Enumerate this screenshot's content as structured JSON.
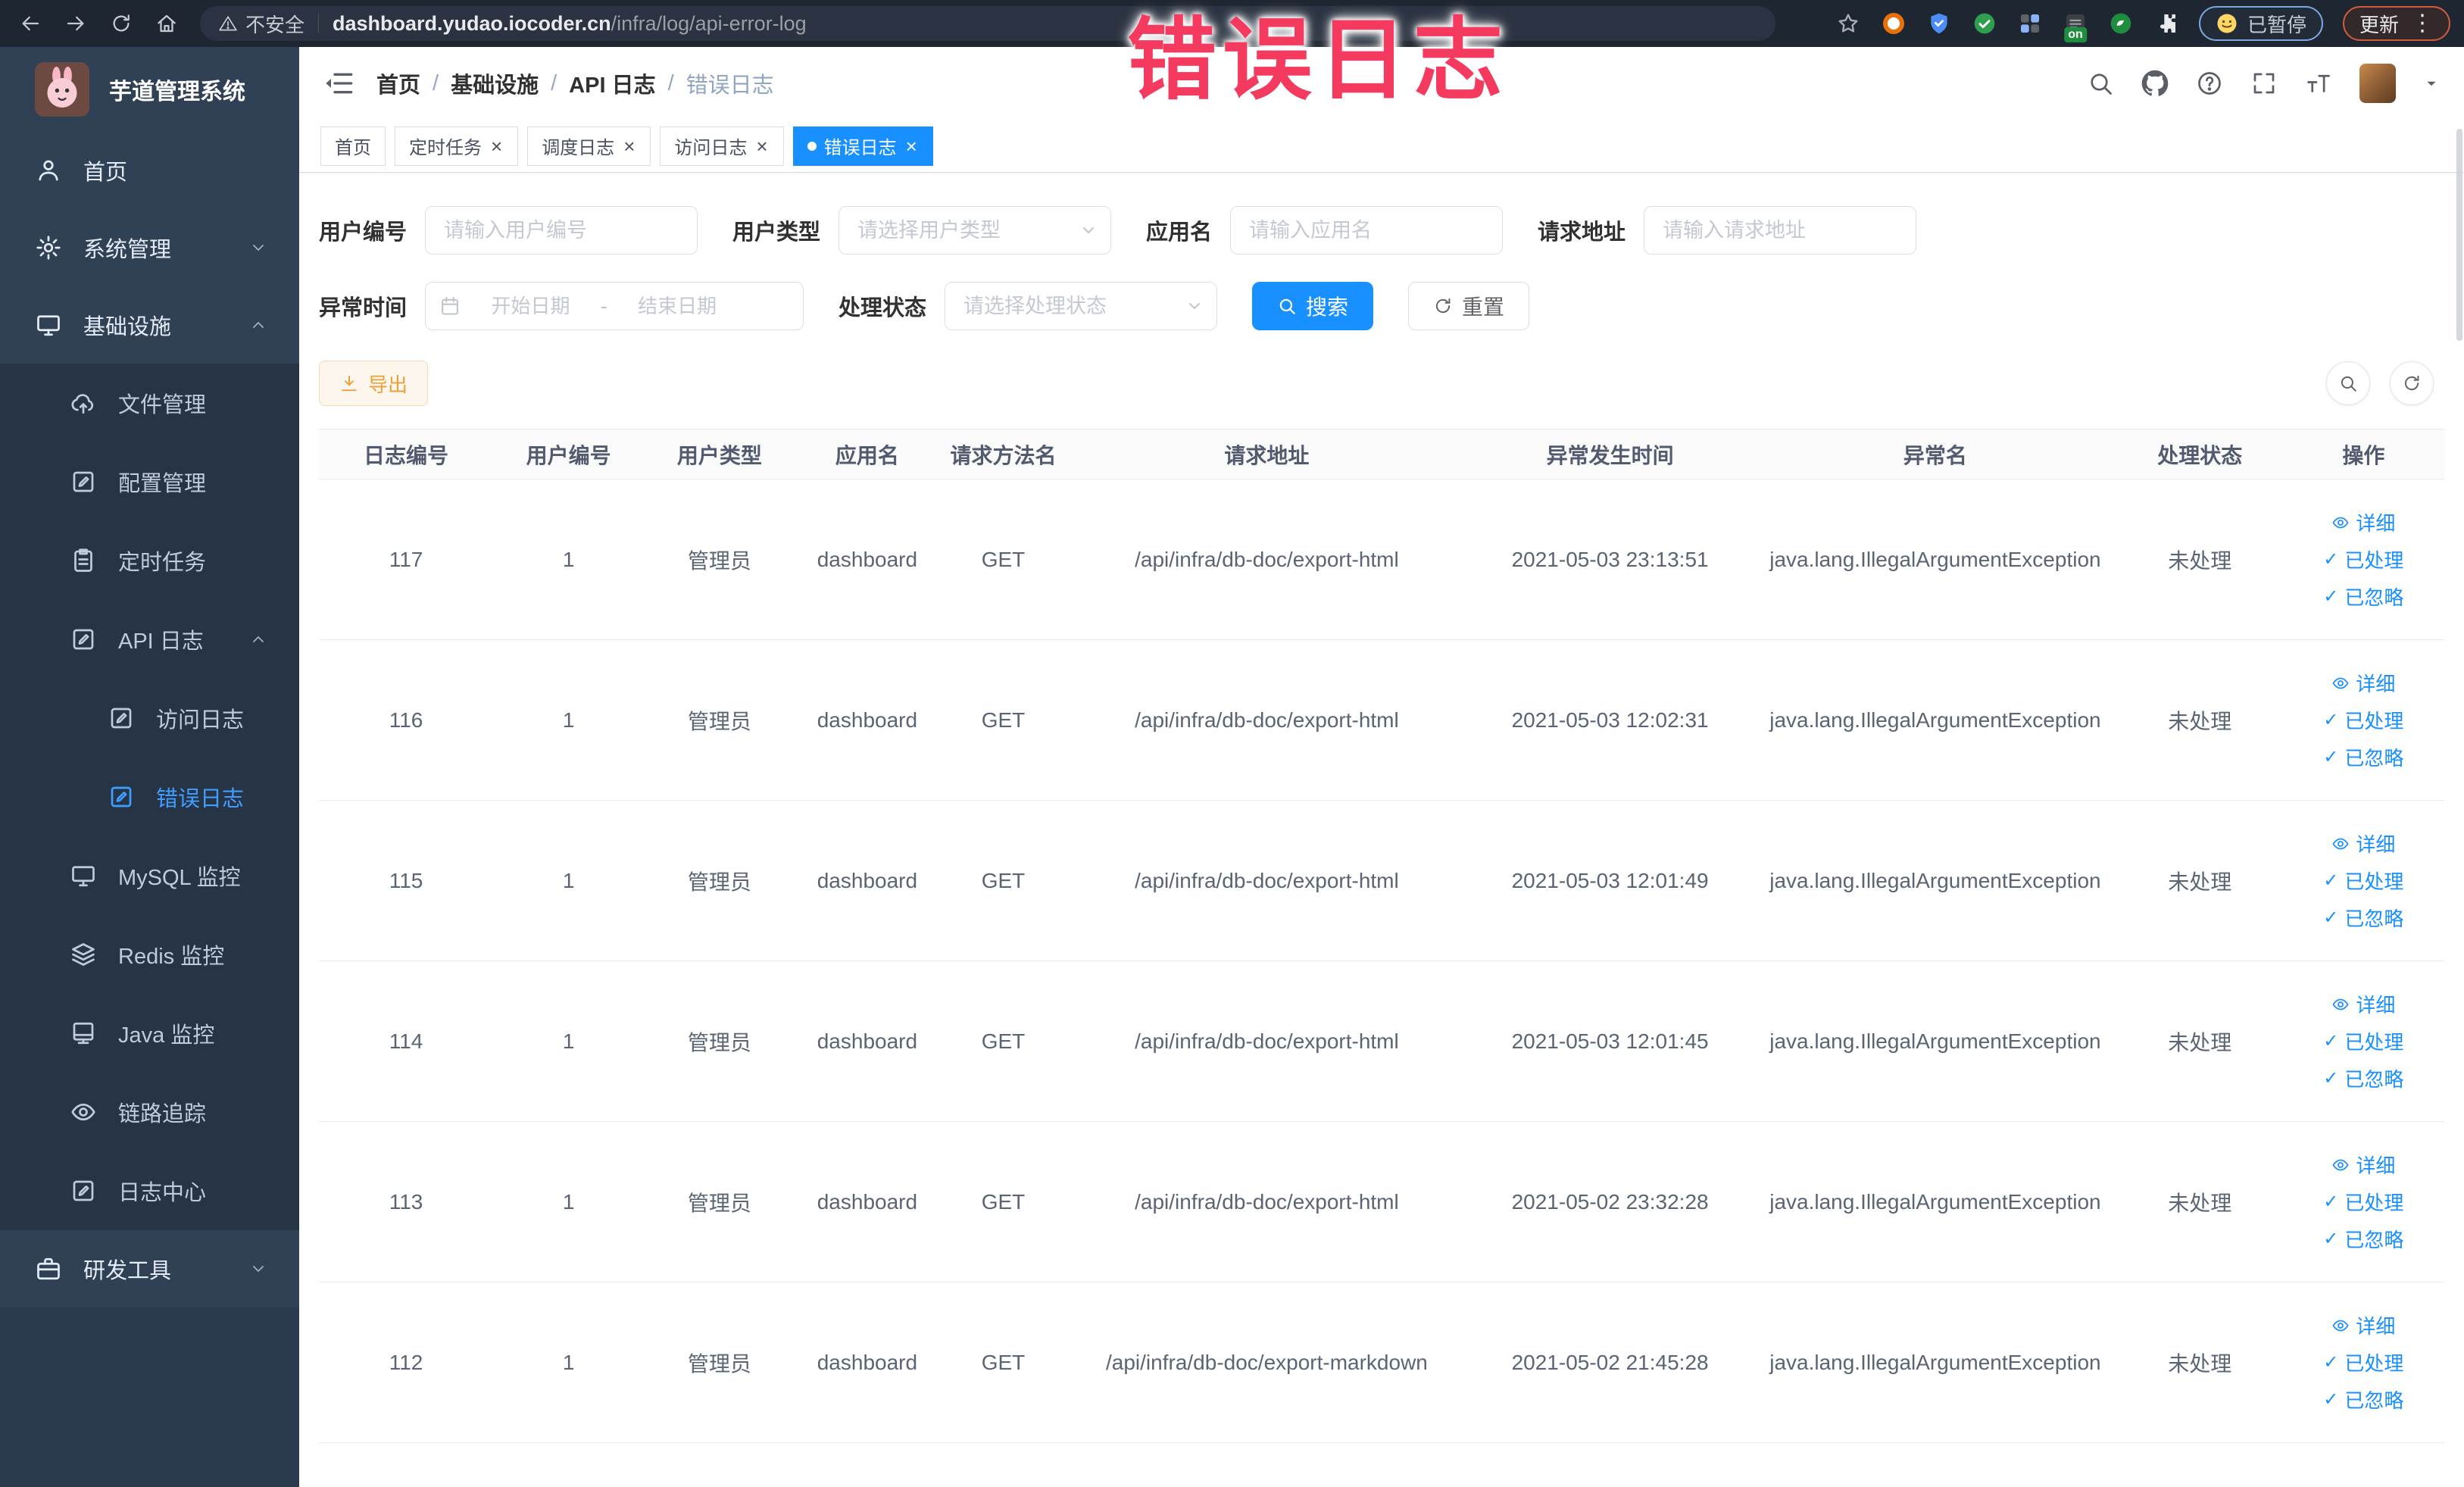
{
  "browser": {
    "security_label": "不安全",
    "url_domain": "dashboard.yudao.iocoder.cn",
    "url_path": "/infra/log/api-error-log",
    "paused_label": "已暂停",
    "update_label": "更新",
    "on_badge": "on"
  },
  "overlay": {
    "text": "错误日志",
    "color": "#f43a5f"
  },
  "sidebar": {
    "title": "芋道管理系统",
    "items": [
      {
        "slug": "home",
        "label": "首页",
        "icon": "home-icon",
        "level": 1
      },
      {
        "slug": "system-management",
        "label": "系统管理",
        "icon": "gear-icon",
        "level": 1,
        "chevron": "down"
      },
      {
        "slug": "infrastructure",
        "label": "基础设施",
        "icon": "monitor-icon",
        "level": 1,
        "chevron": "up"
      },
      {
        "slug": "file-management",
        "label": "文件管理",
        "icon": "cloud-upload-icon",
        "level": 2
      },
      {
        "slug": "config-management",
        "label": "配置管理",
        "icon": "edit-square-icon",
        "level": 2
      },
      {
        "slug": "scheduled-tasks",
        "label": "定时任务",
        "icon": "clipboard-icon",
        "level": 2
      },
      {
        "slug": "api-log",
        "label": "API 日志",
        "icon": "edit-square-icon",
        "level": 2,
        "chevron": "up"
      },
      {
        "slug": "access-log",
        "label": "访问日志",
        "icon": "edit-square-icon",
        "level": 3
      },
      {
        "slug": "error-log",
        "label": "错误日志",
        "icon": "edit-square-icon",
        "level": 3,
        "active": true
      },
      {
        "slug": "mysql-monitor",
        "label": "MySQL 监控",
        "icon": "monitor-icon",
        "level": 2
      },
      {
        "slug": "redis-monitor",
        "label": "Redis 监控",
        "icon": "stack-icon",
        "level": 2
      },
      {
        "slug": "java-monitor",
        "label": "Java 监控",
        "icon": "pc-icon",
        "level": 2
      },
      {
        "slug": "trace",
        "label": "链路追踪",
        "icon": "eye-icon",
        "level": 2
      },
      {
        "slug": "log-center",
        "label": "日志中心",
        "icon": "edit-square-icon",
        "level": 2
      },
      {
        "slug": "dev-tools",
        "label": "研发工具",
        "icon": "briefcase-icon",
        "level": 1,
        "chevron": "down"
      }
    ]
  },
  "header": {
    "breadcrumb": [
      "首页",
      "基础设施",
      "API 日志",
      "错误日志"
    ]
  },
  "tabs": [
    {
      "slug": "home",
      "label": "首页",
      "closable": false,
      "active": false
    },
    {
      "slug": "scheduled-tasks",
      "label": "定时任务",
      "closable": true,
      "active": false
    },
    {
      "slug": "schedule-log",
      "label": "调度日志",
      "closable": true,
      "active": false
    },
    {
      "slug": "access-log",
      "label": "访问日志",
      "closable": true,
      "active": false
    },
    {
      "slug": "error-log",
      "label": "错误日志",
      "closable": true,
      "active": true
    }
  ],
  "filters": {
    "user_id": {
      "label": "用户编号",
      "placeholder": "请输入用户编号"
    },
    "user_type": {
      "label": "用户类型",
      "placeholder": "请选择用户类型"
    },
    "app_name": {
      "label": "应用名",
      "placeholder": "请输入应用名"
    },
    "request_url": {
      "label": "请求地址",
      "placeholder": "请输入请求地址"
    },
    "exception_time": {
      "label": "异常时间",
      "start_placeholder": "开始日期",
      "separator": "-",
      "end_placeholder": "结束日期"
    },
    "process_status": {
      "label": "处理状态",
      "placeholder": "请选择处理状态"
    },
    "search_label": "搜索",
    "reset_label": "重置"
  },
  "toolbar": {
    "export_label": "导出"
  },
  "table": {
    "columns": [
      "日志编号",
      "用户编号",
      "用户类型",
      "应用名",
      "请求方法名",
      "请求地址",
      "异常发生时间",
      "异常名",
      "处理状态",
      "操作"
    ],
    "action_labels": [
      "详细",
      "已处理",
      "已忽略"
    ],
    "rows": [
      {
        "id": "117",
        "user_id": "1",
        "user_type": "管理员",
        "app": "dashboard",
        "method": "GET",
        "url": "/api/infra/db-doc/export-html",
        "time": "2021-05-03 23:13:51",
        "exception": "java.lang.IllegalArgumentException",
        "status": "未处理"
      },
      {
        "id": "116",
        "user_id": "1",
        "user_type": "管理员",
        "app": "dashboard",
        "method": "GET",
        "url": "/api/infra/db-doc/export-html",
        "time": "2021-05-03 12:02:31",
        "exception": "java.lang.IllegalArgumentException",
        "status": "未处理"
      },
      {
        "id": "115",
        "user_id": "1",
        "user_type": "管理员",
        "app": "dashboard",
        "method": "GET",
        "url": "/api/infra/db-doc/export-html",
        "time": "2021-05-03 12:01:49",
        "exception": "java.lang.IllegalArgumentException",
        "status": "未处理"
      },
      {
        "id": "114",
        "user_id": "1",
        "user_type": "管理员",
        "app": "dashboard",
        "method": "GET",
        "url": "/api/infra/db-doc/export-html",
        "time": "2021-05-03 12:01:45",
        "exception": "java.lang.IllegalArgumentException",
        "status": "未处理"
      },
      {
        "id": "113",
        "user_id": "1",
        "user_type": "管理员",
        "app": "dashboard",
        "method": "GET",
        "url": "/api/infra/db-doc/export-html",
        "time": "2021-05-02 23:32:28",
        "exception": "java.lang.IllegalArgumentException",
        "status": "未处理"
      },
      {
        "id": "112",
        "user_id": "1",
        "user_type": "管理员",
        "app": "dashboard",
        "method": "GET",
        "url": "/api/infra/db-doc/export-markdown",
        "time": "2021-05-02 21:45:28",
        "exception": "java.lang.IllegalArgumentException",
        "status": "未处理"
      }
    ]
  },
  "colors": {
    "primary": "#1890ff",
    "menu_active": "#409eff",
    "sidebar_bg": "#304156",
    "submenu_bg": "#263445",
    "export_orange": "#eba039"
  }
}
